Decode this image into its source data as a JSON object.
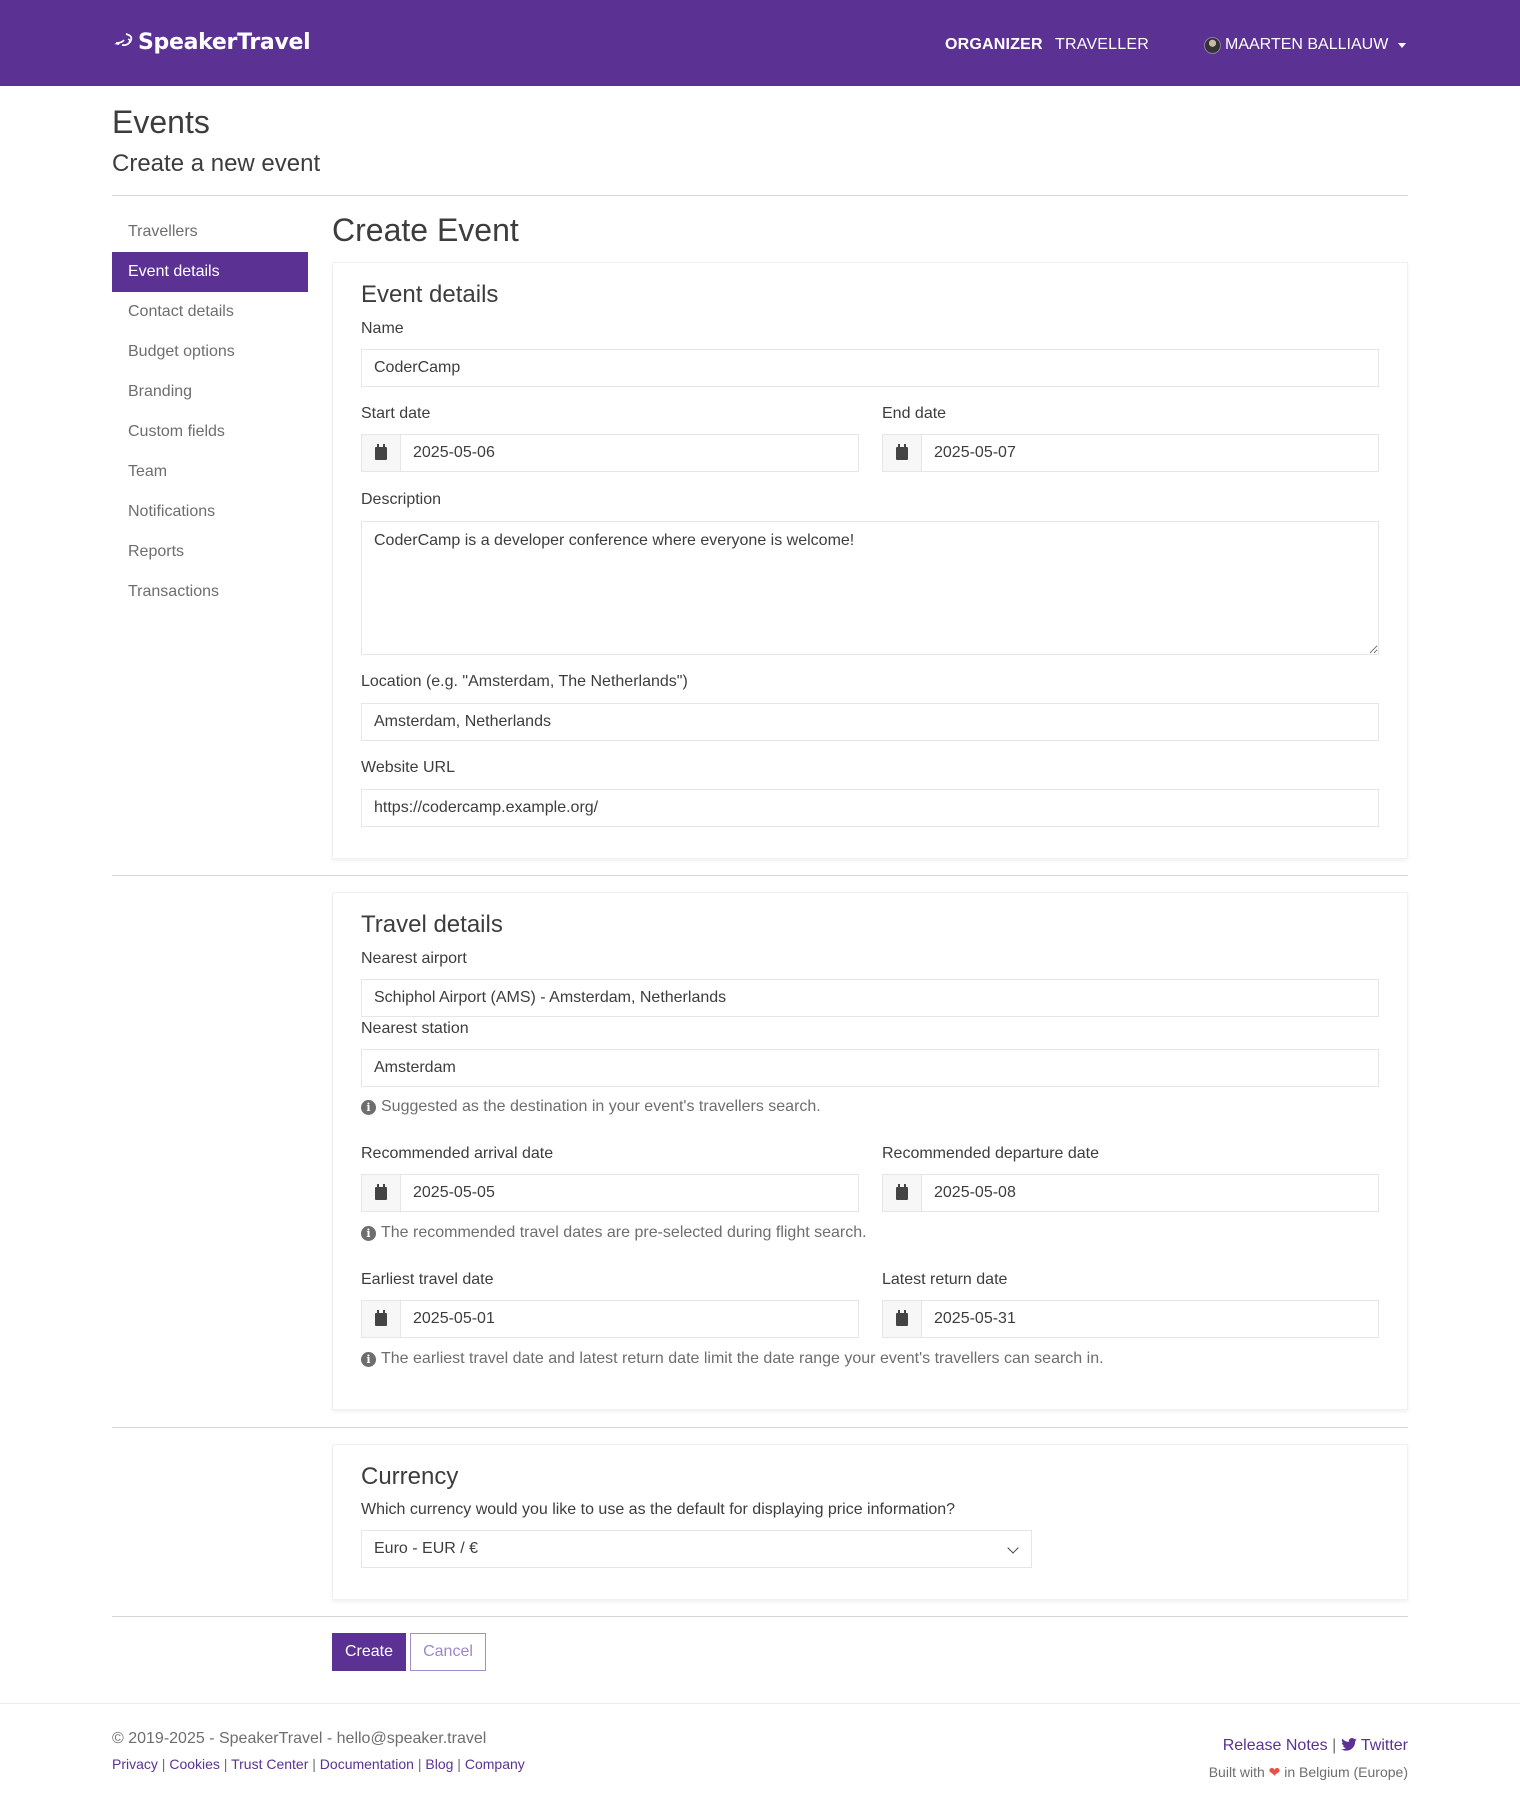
{
  "navbar": {
    "brand": "SpeakerTravel",
    "links": [
      {
        "label": "ORGANIZER",
        "active": true
      },
      {
        "label": "TRAVELLER",
        "active": false
      }
    ],
    "user": {
      "name": "MAARTEN BALLIAUW"
    }
  },
  "header": {
    "title": "Events",
    "subtitle": "Create a new event"
  },
  "sidebar": {
    "items": [
      {
        "label": "Travellers",
        "active": false
      },
      {
        "label": "Event details",
        "active": true
      },
      {
        "label": "Contact details",
        "active": false
      },
      {
        "label": "Budget options",
        "active": false
      },
      {
        "label": "Branding",
        "active": false
      },
      {
        "label": "Custom fields",
        "active": false
      },
      {
        "label": "Team",
        "active": false
      },
      {
        "label": "Notifications",
        "active": false
      },
      {
        "label": "Reports",
        "active": false
      },
      {
        "label": "Transactions",
        "active": false
      }
    ]
  },
  "main": {
    "title": "Create Event",
    "event_details": {
      "heading": "Event details",
      "name_label": "Name",
      "name_value": "CoderCamp",
      "start_label": "Start date",
      "start_value": "2025-05-06",
      "end_label": "End date",
      "end_value": "2025-05-07",
      "description_label": "Description",
      "description_value": "CoderCamp is a developer conference where everyone is welcome!",
      "location_label": "Location (e.g. \"Amsterdam, The Netherlands\")",
      "location_value": "Amsterdam, Netherlands",
      "website_label": "Website URL",
      "website_value": "https://codercamp.example.org/"
    },
    "travel_details": {
      "heading": "Travel details",
      "airport_label": "Nearest airport",
      "airport_value": "Schiphol Airport (AMS) - Amsterdam, Netherlands",
      "station_label": "Nearest station",
      "station_value": "Amsterdam",
      "station_help": "Suggested as the destination in your event's travellers search.",
      "arrival_label": "Recommended arrival date",
      "arrival_value": "2025-05-05",
      "departure_label": "Recommended departure date",
      "departure_value": "2025-05-08",
      "recommended_help": "The recommended travel dates are pre-selected during flight search.",
      "earliest_label": "Earliest travel date",
      "earliest_value": "2025-05-01",
      "latest_label": "Latest return date",
      "latest_value": "2025-05-31",
      "range_help": "The earliest travel date and latest return date limit the date range your event's travellers can search in."
    },
    "currency": {
      "heading": "Currency",
      "question": "Which currency would you like to use as the default for displaying price information?",
      "selected": "Euro - EUR / €"
    },
    "actions": {
      "create_label": "Create",
      "cancel_label": "Cancel"
    }
  },
  "footer": {
    "copyright": "© 2019-2025 - SpeakerTravel - hello@speaker.travel",
    "links": [
      "Privacy",
      "Cookies",
      "Trust Center",
      "Documentation",
      "Blog",
      "Company"
    ],
    "release_notes": "Release Notes",
    "twitter": "Twitter",
    "built_prefix": "Built with",
    "built_suffix": "in Belgium (Europe)"
  },
  "colors": {
    "brand": "#5b3293",
    "text": "#3d3d3d",
    "muted": "#6e6e6e"
  }
}
